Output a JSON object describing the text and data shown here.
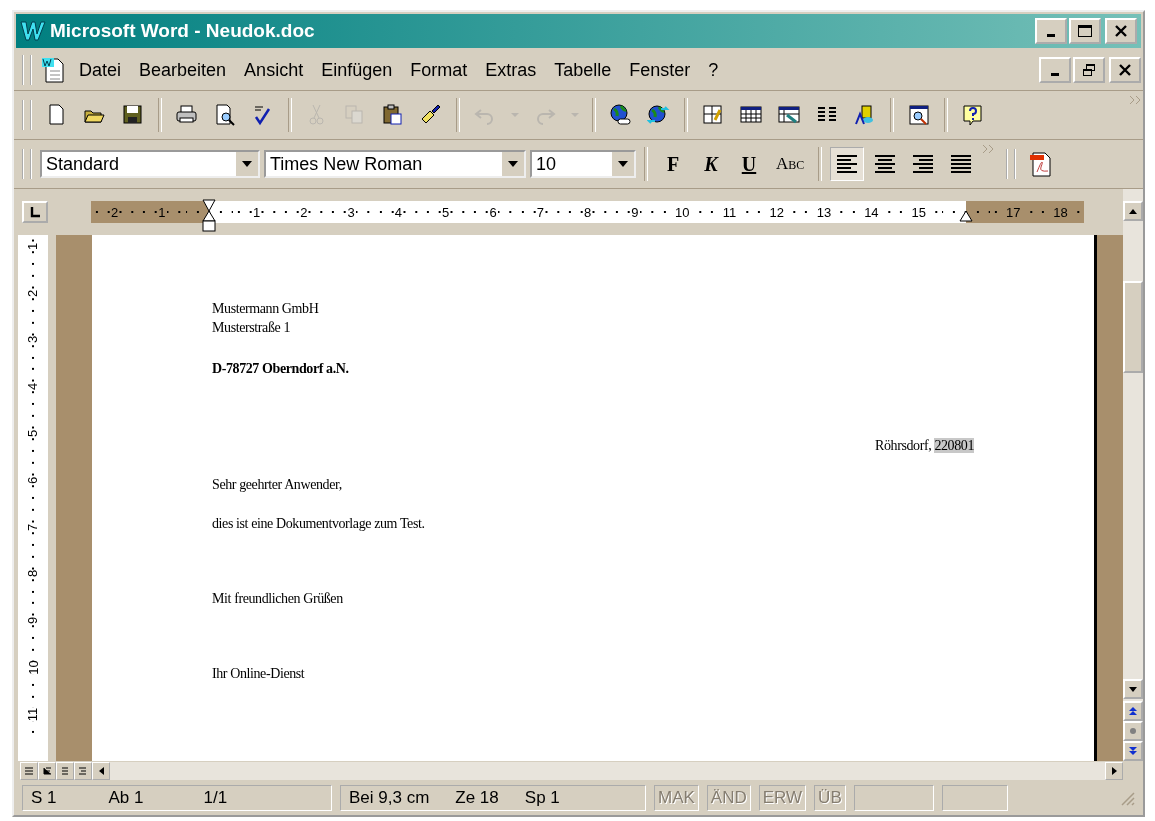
{
  "window": {
    "title": "Microsoft Word - Neudok.doc"
  },
  "menu_bar": {
    "items": [
      {
        "label": "Datei"
      },
      {
        "label": "Bearbeiten"
      },
      {
        "label": "Ansicht"
      },
      {
        "label": "Einfügen"
      },
      {
        "label": "Format"
      },
      {
        "label": "Extras"
      },
      {
        "label": "Tabelle"
      },
      {
        "label": "Fenster"
      },
      {
        "label": "?"
      }
    ]
  },
  "standard_toolbar": [
    {
      "kind": "new",
      "disabled": false
    },
    {
      "kind": "open",
      "disabled": false
    },
    {
      "kind": "save",
      "disabled": false
    },
    {
      "kind": "separator"
    },
    {
      "kind": "print",
      "disabled": false
    },
    {
      "kind": "preview",
      "disabled": false
    },
    {
      "kind": "spell",
      "disabled": false
    },
    {
      "kind": "separator"
    },
    {
      "kind": "cut",
      "disabled": true
    },
    {
      "kind": "copy",
      "disabled": true
    },
    {
      "kind": "paste",
      "disabled": false
    },
    {
      "kind": "painter",
      "disabled": false
    },
    {
      "kind": "separator"
    },
    {
      "kind": "undo",
      "disabled": true
    },
    {
      "kind": "dropdown",
      "disabled": true
    },
    {
      "kind": "redo",
      "disabled": true
    },
    {
      "kind": "dropdown",
      "disabled": true
    },
    {
      "kind": "separator"
    },
    {
      "kind": "globe-link",
      "disabled": false
    },
    {
      "kind": "globe-arrows",
      "disabled": false
    },
    {
      "kind": "separator"
    },
    {
      "kind": "table-draw",
      "disabled": false
    },
    {
      "kind": "table-grid",
      "disabled": false
    },
    {
      "kind": "table-edit",
      "disabled": false
    },
    {
      "kind": "columns",
      "disabled": false
    },
    {
      "kind": "wordart",
      "disabled": false
    },
    {
      "kind": "separator"
    },
    {
      "kind": "docmap",
      "disabled": false
    },
    {
      "kind": "separator"
    },
    {
      "kind": "help",
      "disabled": false
    }
  ],
  "formatting_toolbar": {
    "style_box": {
      "value": "Standard"
    },
    "font_box": {
      "value": "Times New Roman"
    },
    "size_box": {
      "value": "10"
    },
    "format_buttons": [
      {
        "kind": "bold",
        "label": "F"
      },
      {
        "kind": "italic",
        "label": "K"
      },
      {
        "kind": "underline",
        "label": "U"
      },
      {
        "kind": "smallcaps",
        "label": "Abc"
      }
    ],
    "align_buttons": [
      {
        "kind": "left",
        "selected": true
      },
      {
        "kind": "center",
        "selected": false
      },
      {
        "kind": "right",
        "selected": false
      },
      {
        "kind": "justify",
        "selected": false
      }
    ]
  },
  "ruler": {
    "left_margin_labels": [
      "2",
      "1"
    ],
    "body_labels": [
      "1",
      "2",
      "3",
      "4",
      "5",
      "6",
      "7",
      "8",
      "9",
      "10",
      "11",
      "12",
      "13",
      "14",
      "15"
    ],
    "right_margin_labels": [
      "17",
      "18"
    ]
  },
  "vertical_ruler": {
    "labels": [
      "1",
      "2",
      "3",
      "4",
      "5",
      "6",
      "7",
      "8",
      "9",
      "10",
      "11"
    ]
  },
  "document": {
    "paragraphs": [
      {
        "kind": "line",
        "text": "Mustermann GmbH"
      },
      {
        "kind": "line",
        "text": "Musterstraße 1"
      },
      {
        "kind": "bold",
        "text": "D-78727 Oberndorf a.N."
      },
      {
        "kind": "date",
        "text": "Röhrsdorf,",
        "field": "220801"
      },
      {
        "kind": "para",
        "text": "Sehr geehrter Anwender,"
      },
      {
        "kind": "para",
        "text": "dies ist eine Dokumentvorlage zum Test."
      },
      {
        "kind": "para",
        "text": "Mit freundlichen Grüßen"
      },
      {
        "kind": "para",
        "text": "Ihr Online-Dienst"
      }
    ]
  },
  "status_bar": {
    "page_info": [
      {
        "text": "S 1"
      },
      {
        "text": "Ab 1"
      },
      {
        "text": "1/1"
      }
    ],
    "position_info": [
      {
        "text": "Bei 9,3 cm"
      },
      {
        "text": "Ze 18"
      },
      {
        "text": "Sp 1"
      }
    ],
    "modes": [
      {
        "label": "MAK",
        "disabled": true
      },
      {
        "label": "ÄND",
        "disabled": true
      },
      {
        "label": "ERW",
        "disabled": true
      },
      {
        "label": "ÜB",
        "disabled": true
      }
    ]
  }
}
